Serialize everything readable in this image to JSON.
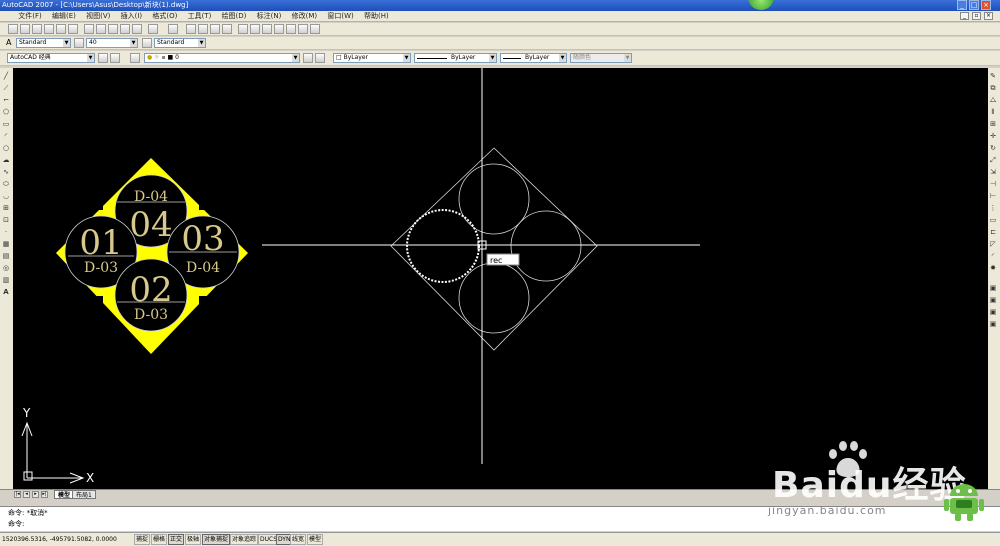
{
  "window": {
    "title": "AutoCAD 2007 - [C:\\Users\\Asus\\Desktop\\新块(1).dwg]"
  },
  "menubar": {
    "items": [
      "文件(F)",
      "编辑(E)",
      "视图(V)",
      "插入(I)",
      "格式(O)",
      "工具(T)",
      "绘图(D)",
      "标注(N)",
      "修改(M)",
      "窗口(W)",
      "帮助(H)"
    ]
  },
  "styles": {
    "text_style": "Standard",
    "dim_scale": "40",
    "dim_style": "Standard"
  },
  "workspace": {
    "name": "AutoCAD 经典"
  },
  "layer": {
    "current": "0"
  },
  "properties": {
    "color": "ByLayer",
    "linetype": "ByLayer",
    "lineweight": "ByLayer",
    "plot_style": "随颜色"
  },
  "drawing": {
    "tag_top_small": "D-04",
    "tag_top_big": "04",
    "tag_left_big": "01",
    "tag_left_small": "D-03",
    "tag_right_big": "03",
    "tag_right_small": "D-04",
    "tag_bottom_big": "02",
    "tag_bottom_small": "D-03",
    "dynamic_input": "rec",
    "ucs_x": "X",
    "ucs_y": "Y"
  },
  "layout_tabs": [
    "模型",
    "布局1"
  ],
  "command": {
    "line1": "命令: *取消*",
    "line2": "命令:"
  },
  "status": {
    "coordinates": "1520396.5316, -495791.5082, 0.0000",
    "toggles": [
      "捕捉",
      "栅格",
      "正交",
      "极轴",
      "对象捕捉",
      "对象追踪",
      "DUCS",
      "DYN",
      "线宽",
      "模型"
    ]
  },
  "watermark": {
    "brand": "Baidu经验",
    "url": "jingyan.baidu.com"
  },
  "colors": {
    "canvas": "#000000",
    "highlight": "#ffff00",
    "geometry": "#ffffff",
    "tag_text": "#d8c98a"
  }
}
